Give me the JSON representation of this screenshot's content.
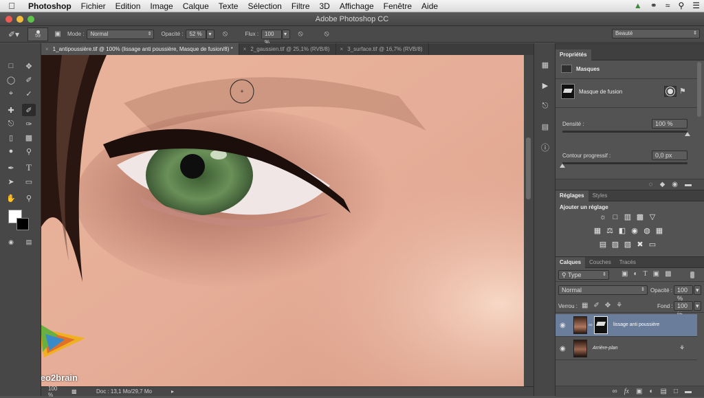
{
  "menubar": {
    "app": "Photoshop",
    "items": [
      "Fichier",
      "Edition",
      "Image",
      "Calque",
      "Texte",
      "Sélection",
      "Filtre",
      "3D",
      "Affichage",
      "Fenêtre",
      "Aide"
    ]
  },
  "window": {
    "title": "Adobe Photoshop CC"
  },
  "options": {
    "brush_size": "59",
    "mode_label": "Mode :",
    "mode_value": "Normal",
    "opacity_label": "Opacité :",
    "opacity_value": "52 %",
    "flow_label": "Flux :",
    "flow_value": "100 %",
    "workspace": "Beauté"
  },
  "tabs": [
    {
      "label": "1_antipoussière.tif @ 100% (lissage anti poussière, Masque de fusion/8) *"
    },
    {
      "label": "2_gaussien.tif @ 25,1% (RVB/8)"
    },
    {
      "label": "3_surface.tif @ 16,7% (RVB/8)"
    }
  ],
  "status": {
    "zoom": "100 %",
    "doc": "Doc : 13,1 Mo/29,7 Mo"
  },
  "watermark": {
    "text": "video2brain"
  },
  "properties": {
    "title": "Propriétés",
    "section": "Masques",
    "mask_name": "Masque de fusion",
    "density_label": "Densité :",
    "density_value": "100 %",
    "density": 1.0,
    "feather_label": "Contour progressif :",
    "feather_value": "0,0 px",
    "feather": 0.0
  },
  "adjustments": {
    "tabs": [
      "Réglages",
      "Styles"
    ],
    "heading": "Ajouter un réglage"
  },
  "layers": {
    "tabs": [
      "Calques",
      "Couches",
      "Tracés"
    ],
    "filter": "Type",
    "blend_mode": "Normal",
    "opacity_label": "Opacité :",
    "opacity_value": "100 %",
    "lock_label": "Verrou :",
    "fill_label": "Fond :",
    "fill_value": "100 %",
    "items": [
      {
        "name": "lissage anti poussière",
        "selected": true
      },
      {
        "name": "Arrière-plan",
        "selected": false
      }
    ]
  },
  "colors": {
    "accent": "#6a7e9c",
    "panel": "#535353",
    "dark": "#3f3f3f"
  }
}
